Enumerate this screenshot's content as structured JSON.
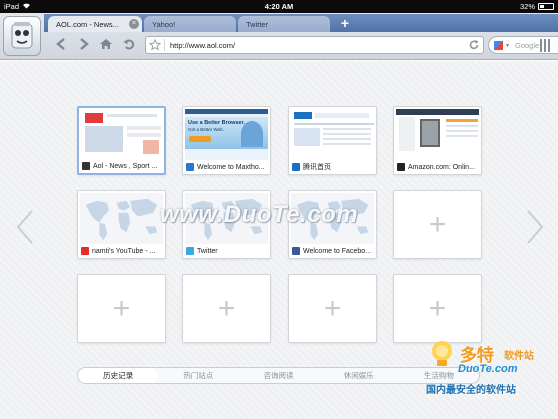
{
  "status_bar": {
    "device": "iPad",
    "time": "4:20 AM",
    "battery_text": "32%",
    "battery_level": 0.32
  },
  "tabs": [
    {
      "label": "AOL.com - News...",
      "active": true
    },
    {
      "label": "Yahoo!",
      "active": false
    },
    {
      "label": "Twitter",
      "active": false
    }
  ],
  "new_tab_label": "+",
  "address_bar": {
    "url": "http://www.aol.com/"
  },
  "search_box": {
    "placeholder": "Google"
  },
  "speed_dial": [
    {
      "caption": "Aol - News , Sport ...",
      "favicon": "aol-icon",
      "fav_color": "#333333",
      "thumb": "aol"
    },
    {
      "caption": "Welcome to Maxtho...",
      "favicon": "maxthon-icon",
      "fav_color": "#2b78c8",
      "thumb": "maxthon"
    },
    {
      "caption": "腾讯首页",
      "favicon": "qq-icon",
      "fav_color": "#1a6fc1",
      "thumb": "qq"
    },
    {
      "caption": "Amazon.com: Onlin...",
      "favicon": "amazon-icon",
      "fav_color": "#222222",
      "thumb": "amazon"
    },
    {
      "caption": "namti's YouTube - ...",
      "favicon": "youtube-icon",
      "fav_color": "#e52d27",
      "thumb": "map"
    },
    {
      "caption": "Twitter",
      "favicon": "twitter-icon",
      "fav_color": "#3aa9e2",
      "thumb": "map"
    },
    {
      "caption": "Welcome to Facebo...",
      "favicon": "facebook-icon",
      "fav_color": "#3b5998",
      "thumb": "map"
    },
    {
      "caption": "",
      "thumb": "plus"
    },
    {
      "caption": "",
      "thumb": "plus"
    },
    {
      "caption": "",
      "thumb": "plus"
    },
    {
      "caption": "",
      "thumb": "plus"
    },
    {
      "caption": "",
      "thumb": "plus"
    }
  ],
  "thumb_text": {
    "maxthon_headline": "Use a Better Browser.",
    "maxthon_sub": "Get a Better Web."
  },
  "bottom_tabs": [
    {
      "label": "历史记录",
      "active": true
    },
    {
      "label": "热门站点",
      "active": false
    },
    {
      "label": "咨询阅读",
      "active": false
    },
    {
      "label": "休闲娱乐",
      "active": false
    },
    {
      "label": "生活购物",
      "active": false
    }
  ],
  "watermark": {
    "text": "www.DuoTe.com"
  },
  "corner_logo": {
    "line1": "多特",
    "line1_suffix": "软件站",
    "line2": "DuoTe.com",
    "line3": "国内最安全的软件站"
  },
  "colors": {
    "tab_bar": "#5a7cb2",
    "accent": "#8fb3e2"
  }
}
